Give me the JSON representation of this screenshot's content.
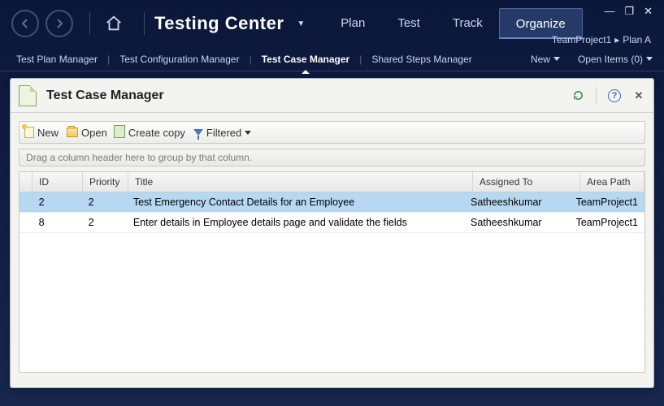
{
  "title_controls": {
    "minimize": "—",
    "restore": "❐",
    "close": "✕"
  },
  "brand": "Testing Center",
  "top_tabs": [
    "Plan",
    "Test",
    "Track",
    "Organize"
  ],
  "top_active": "Organize",
  "crumbs": {
    "project": "TeamProject1",
    "plan": "Plan A",
    "sep": "▸"
  },
  "subnav": {
    "items": [
      "Test Plan Manager",
      "Test Configuration Manager",
      "Test Case Manager",
      "Shared Steps Manager"
    ],
    "active": "Test Case Manager",
    "new_label": "New",
    "open_items_label": "Open Items (0)"
  },
  "panel": {
    "title": "Test Case Manager",
    "help_glyph": "?",
    "close_glyph": "✕"
  },
  "toolbar": {
    "new": "New",
    "open": "Open",
    "copy": "Create copy",
    "filtered": "Filtered"
  },
  "group_hint": "Drag a column header here to group by that column.",
  "grid": {
    "columns": [
      "ID",
      "Priority",
      "Title",
      "Assigned To",
      "Area Path"
    ],
    "rows": [
      {
        "id": "2",
        "priority": "2",
        "title": "Test Emergency Contact Details for an Employee",
        "assigned_to": "Satheeshkumar",
        "area_path": "TeamProject1",
        "selected": true
      },
      {
        "id": "8",
        "priority": "2",
        "title": "Enter details in Employee details page and validate the fields",
        "assigned_to": "Satheeshkumar",
        "area_path": "TeamProject1",
        "selected": false
      }
    ]
  }
}
